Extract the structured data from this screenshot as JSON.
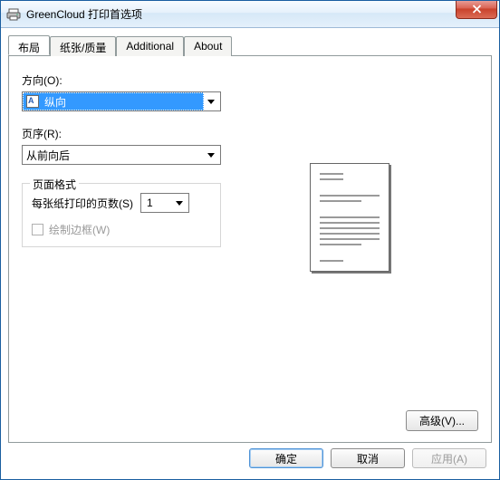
{
  "window": {
    "title": "GreenCloud 打印首选项"
  },
  "tabs": {
    "layout": "布局",
    "paper": "纸张/质量",
    "additional": "Additional",
    "about": "About"
  },
  "layout": {
    "orientation_label": "方向(O):",
    "orientation_value": "纵向",
    "page_order_label": "页序(R):",
    "page_order_value": "从前向后",
    "page_format_legend": "页面格式",
    "pages_per_sheet_label": "每张纸打印的页数(S)",
    "pages_per_sheet_value": "1",
    "draw_borders_label": "绘制边框(W)",
    "draw_borders_checked": false,
    "draw_borders_enabled": false,
    "advanced_button": "高级(V)..."
  },
  "footer": {
    "ok": "确定",
    "cancel": "取消",
    "apply": "应用(A)",
    "apply_enabled": false
  }
}
